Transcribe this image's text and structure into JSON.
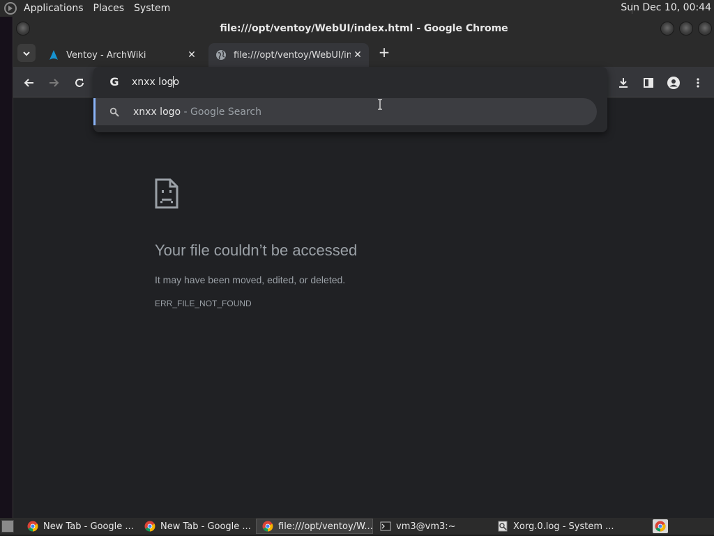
{
  "top_panel": {
    "menus": [
      "Applications",
      "Places",
      "System"
    ],
    "clock": "Sun Dec 10, 00:44"
  },
  "window": {
    "title": "file:///opt/ventoy/WebUI/index.html - Google Chrome"
  },
  "tabs": [
    {
      "label": "Ventoy - ArchWiki",
      "icon": "archlinux-icon"
    },
    {
      "label": "file:///opt/ventoy/WebUI/inde",
      "icon": "globe-icon",
      "active": true
    }
  ],
  "omnibox": {
    "value": "xnxx logo",
    "suggestion_query": "xnxx logo",
    "suggestion_suffix": " - Google Search"
  },
  "error_page": {
    "title": "Your file couldn’t be accessed",
    "message": "It may have been moved, edited, or deleted.",
    "code": "ERR_FILE_NOT_FOUND"
  },
  "taskbar": {
    "tasks": [
      {
        "label": "New Tab - Google ...",
        "icon": "chrome-icon"
      },
      {
        "label": "New Tab - Google ...",
        "icon": "chrome-icon"
      },
      {
        "label": "file:///opt/ventoy/W...",
        "icon": "chrome-icon",
        "active": true
      },
      {
        "label": "vm3@vm3:~",
        "icon": "terminal-icon"
      },
      {
        "label": "Xorg.0.log - System ...",
        "icon": "log-viewer-icon"
      }
    ]
  },
  "colors": {
    "page_bg": "#202124",
    "toolbar_bg": "#35363a",
    "accent": "#8ab4f8",
    "muted_text": "#9aa0a6"
  }
}
